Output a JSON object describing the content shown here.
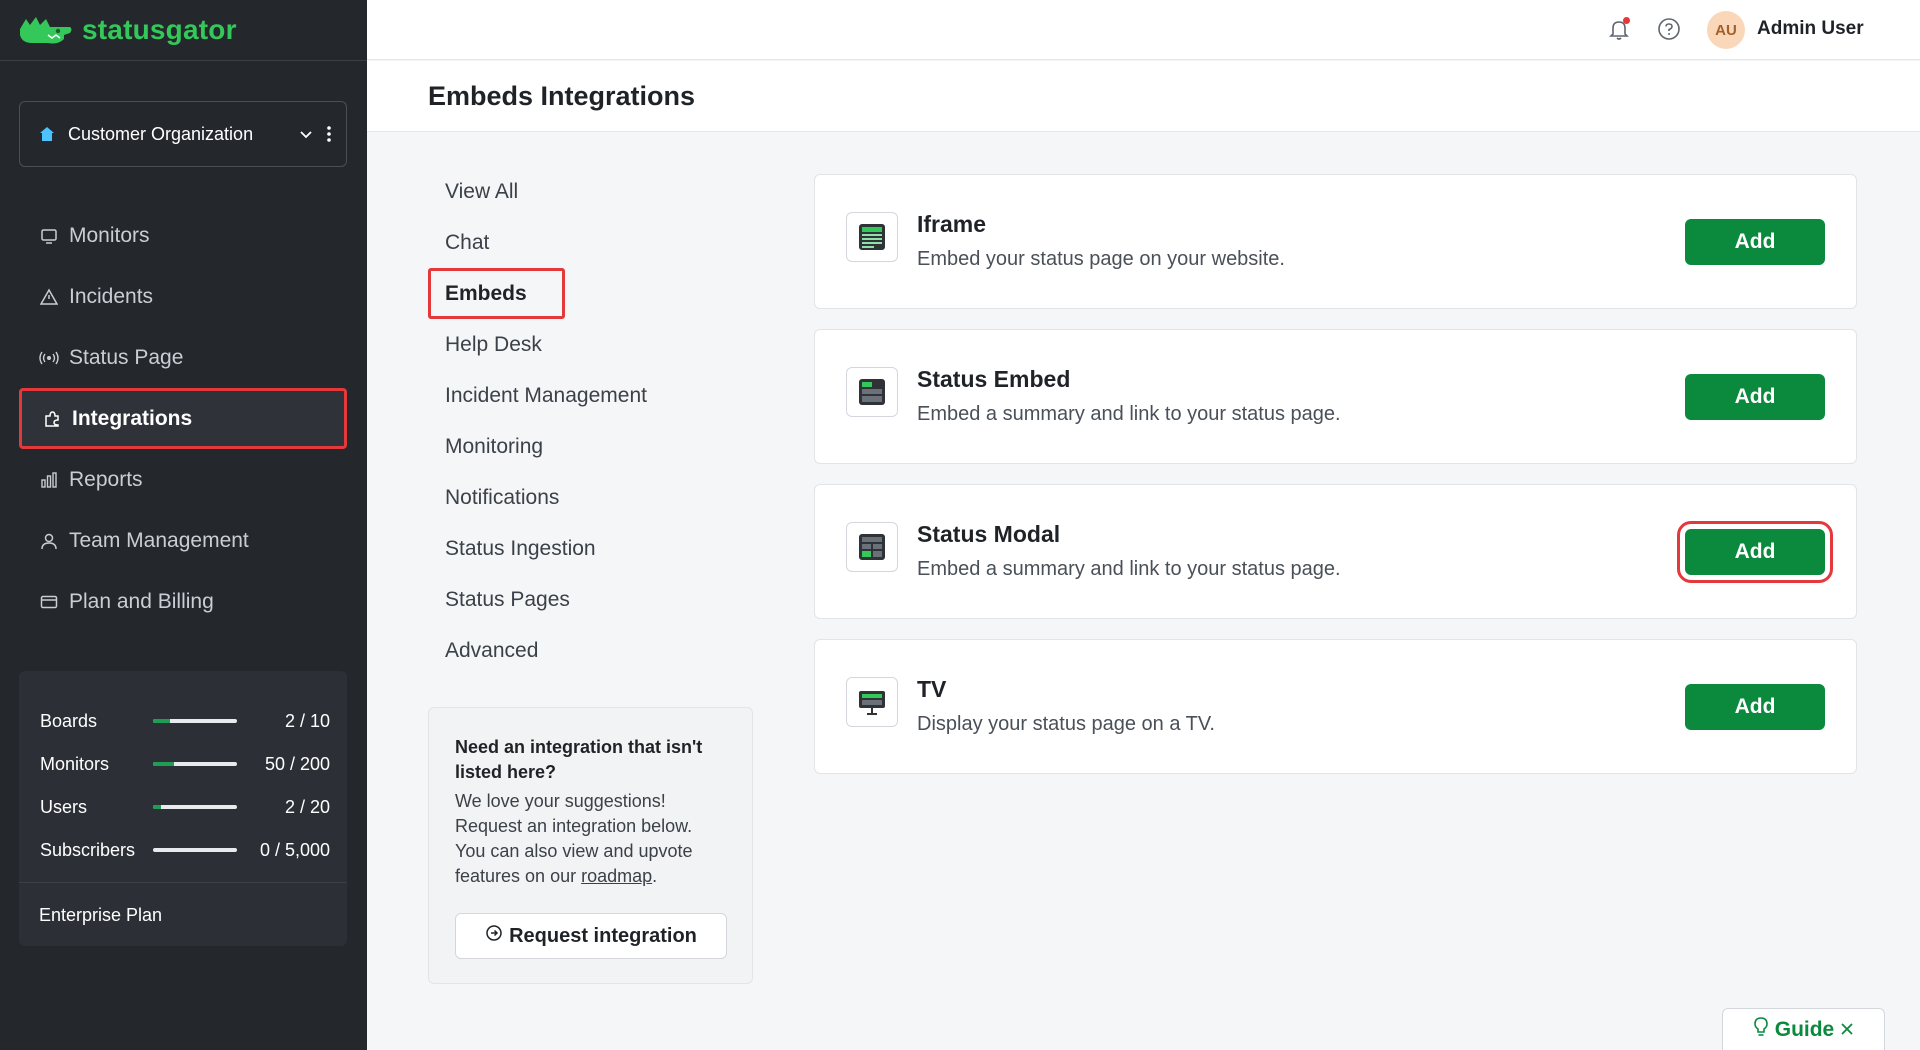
{
  "brand": {
    "name": "statusgator"
  },
  "org": {
    "name": "Customer Organization"
  },
  "sidebar": {
    "items": [
      {
        "label": "Monitors",
        "icon": "monitor-icon"
      },
      {
        "label": "Incidents",
        "icon": "warning-icon"
      },
      {
        "label": "Status Page",
        "icon": "broadcast-icon"
      },
      {
        "label": "Integrations",
        "icon": "puzzle-icon",
        "active": true
      },
      {
        "label": "Reports",
        "icon": "bar-chart-icon"
      },
      {
        "label": "Team Management",
        "icon": "user-icon"
      },
      {
        "label": "Plan and Billing",
        "icon": "credit-card-icon"
      }
    ]
  },
  "usage": {
    "rows": [
      {
        "label": "Boards",
        "value": "2 / 10",
        "fraction": 0.2
      },
      {
        "label": "Monitors",
        "value": "50 / 200",
        "fraction": 0.25
      },
      {
        "label": "Users",
        "value": "2 / 20",
        "fraction": 0.1
      },
      {
        "label": "Subscribers",
        "value": "0 / 5,000",
        "fraction": 0.0
      }
    ],
    "plan": "Enterprise Plan"
  },
  "topbar": {
    "avatar_initials": "AU",
    "user_name": "Admin User"
  },
  "page": {
    "title": "Embeds Integrations"
  },
  "categories": [
    {
      "label": "View All"
    },
    {
      "label": "Chat"
    },
    {
      "label": "Embeds",
      "active": true
    },
    {
      "label": "Help Desk"
    },
    {
      "label": "Incident Management"
    },
    {
      "label": "Monitoring"
    },
    {
      "label": "Notifications"
    },
    {
      "label": "Status Ingestion"
    },
    {
      "label": "Status Pages"
    },
    {
      "label": "Advanced"
    }
  ],
  "suggest": {
    "heading": "Need an integration that isn't listed here?",
    "body_1": "We love your suggestions! Request an integration below. You can also view and upvote features on our ",
    "link": "roadmap",
    "body_2": ".",
    "button": "Request integration"
  },
  "integrations": [
    {
      "title": "Iframe",
      "desc": "Embed your status page on your website.",
      "button": "Add",
      "icon": "iframe-embed-icon"
    },
    {
      "title": "Status Embed",
      "desc": "Embed a summary and link to your status page.",
      "button": "Add",
      "icon": "status-embed-icon"
    },
    {
      "title": "Status Modal",
      "desc": "Embed a summary and link to your status page.",
      "button": "Add",
      "icon": "status-modal-icon",
      "highlighted": true
    },
    {
      "title": "TV",
      "desc": "Display your status page on a TV.",
      "button": "Add",
      "icon": "tv-icon"
    }
  ],
  "guide": {
    "label": "Guide"
  },
  "colors": {
    "accent": "#0b8a3e",
    "brand": "#34c759",
    "sidebar": "#24272c",
    "highlight": "#e5383b"
  }
}
